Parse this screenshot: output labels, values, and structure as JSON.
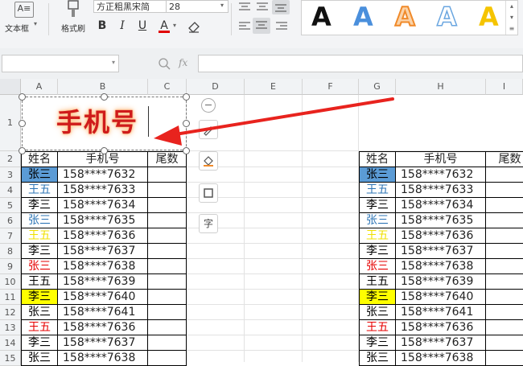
{
  "ribbon": {
    "textbox_label": "文本框",
    "format_painter_label": "格式刷",
    "font_name": "方正粗黑宋简",
    "font_size": "28",
    "bold": "B",
    "italic": "I",
    "underline": "U",
    "font_color_glyph": "A",
    "art_style_letter": "A",
    "colors": {
      "art_black": "#111111",
      "art_blue": "#3a86d6",
      "art_orange": "#f08a2a",
      "art_outline_blue": "#6aa6e0",
      "art_yellow": "#f5c400"
    }
  },
  "formula_bar": {
    "fx": "fx"
  },
  "columns": [
    "A",
    "B",
    "C",
    "D",
    "E",
    "F",
    "G",
    "H",
    "I"
  ],
  "rows": [
    "1",
    "2",
    "3",
    "4",
    "5",
    "6",
    "7",
    "8",
    "9",
    "10",
    "11",
    "12",
    "13",
    "14",
    "15"
  ],
  "art_text": "手机号",
  "side_icons": [
    "minus-circle-icon",
    "pen-icon",
    "fill-bucket-icon",
    "frame-icon",
    "text-char-icon"
  ],
  "side_text_glyph": "字",
  "left_table": {
    "headers": [
      "姓名",
      "手机号",
      "尾数"
    ],
    "rows": [
      {
        "name": "张三",
        "phone": "158****7632",
        "name_color": "#000000",
        "name_bg": "#5b9bd5"
      },
      {
        "name": "王五",
        "phone": "158****7633",
        "name_color": "#2e75b6",
        "name_bg": ""
      },
      {
        "name": "李三",
        "phone": "158****7634",
        "name_color": "#000000",
        "name_bg": ""
      },
      {
        "name": "张三",
        "phone": "158****7635",
        "name_color": "#2e75b6",
        "name_bg": ""
      },
      {
        "name": "王五",
        "phone": "158****7636",
        "name_color": "#f0e000",
        "name_bg": ""
      },
      {
        "name": "李三",
        "phone": "158****7637",
        "name_color": "#000000",
        "name_bg": ""
      },
      {
        "name": "张三",
        "phone": "158****7638",
        "name_color": "#e60000",
        "name_bg": ""
      },
      {
        "name": "王五",
        "phone": "158****7639",
        "name_color": "#000000",
        "name_bg": ""
      },
      {
        "name": "李三",
        "phone": "158****7640",
        "name_color": "#000000",
        "name_bg": "#ffff00"
      },
      {
        "name": "张三",
        "phone": "158****7641",
        "name_color": "#000000",
        "name_bg": ""
      },
      {
        "name": "王五",
        "phone": "158****7636",
        "name_color": "#e60000",
        "name_bg": ""
      },
      {
        "name": "李三",
        "phone": "158****7637",
        "name_color": "#000000",
        "name_bg": ""
      },
      {
        "name": "张三",
        "phone": "158****7638",
        "name_color": "#000000",
        "name_bg": ""
      }
    ]
  },
  "right_table": {
    "headers": [
      "姓名",
      "手机号",
      "尾数"
    ],
    "rows": [
      {
        "name": "张三",
        "phone": "158****7632",
        "name_color": "#000000",
        "name_bg": "#5b9bd5"
      },
      {
        "name": "王五",
        "phone": "158****7633",
        "name_color": "#2e75b6",
        "name_bg": ""
      },
      {
        "name": "李三",
        "phone": "158****7634",
        "name_color": "#000000",
        "name_bg": ""
      },
      {
        "name": "张三",
        "phone": "158****7635",
        "name_color": "#2e75b6",
        "name_bg": ""
      },
      {
        "name": "王五",
        "phone": "158****7636",
        "name_color": "#f0e000",
        "name_bg": ""
      },
      {
        "name": "李三",
        "phone": "158****7637",
        "name_color": "#000000",
        "name_bg": ""
      },
      {
        "name": "张三",
        "phone": "158****7638",
        "name_color": "#e60000",
        "name_bg": ""
      },
      {
        "name": "王五",
        "phone": "158****7639",
        "name_color": "#000000",
        "name_bg": ""
      },
      {
        "name": "李三",
        "phone": "158****7640",
        "name_color": "#000000",
        "name_bg": "#ffff00"
      },
      {
        "name": "张三",
        "phone": "158****7641",
        "name_color": "#000000",
        "name_bg": ""
      },
      {
        "name": "王五",
        "phone": "158****7636",
        "name_color": "#e60000",
        "name_bg": ""
      },
      {
        "name": "李三",
        "phone": "158****7637",
        "name_color": "#000000",
        "name_bg": ""
      },
      {
        "name": "张三",
        "phone": "158****7638",
        "name_color": "#000000",
        "name_bg": ""
      }
    ]
  },
  "annotation_arrow_color": "#e8231e"
}
